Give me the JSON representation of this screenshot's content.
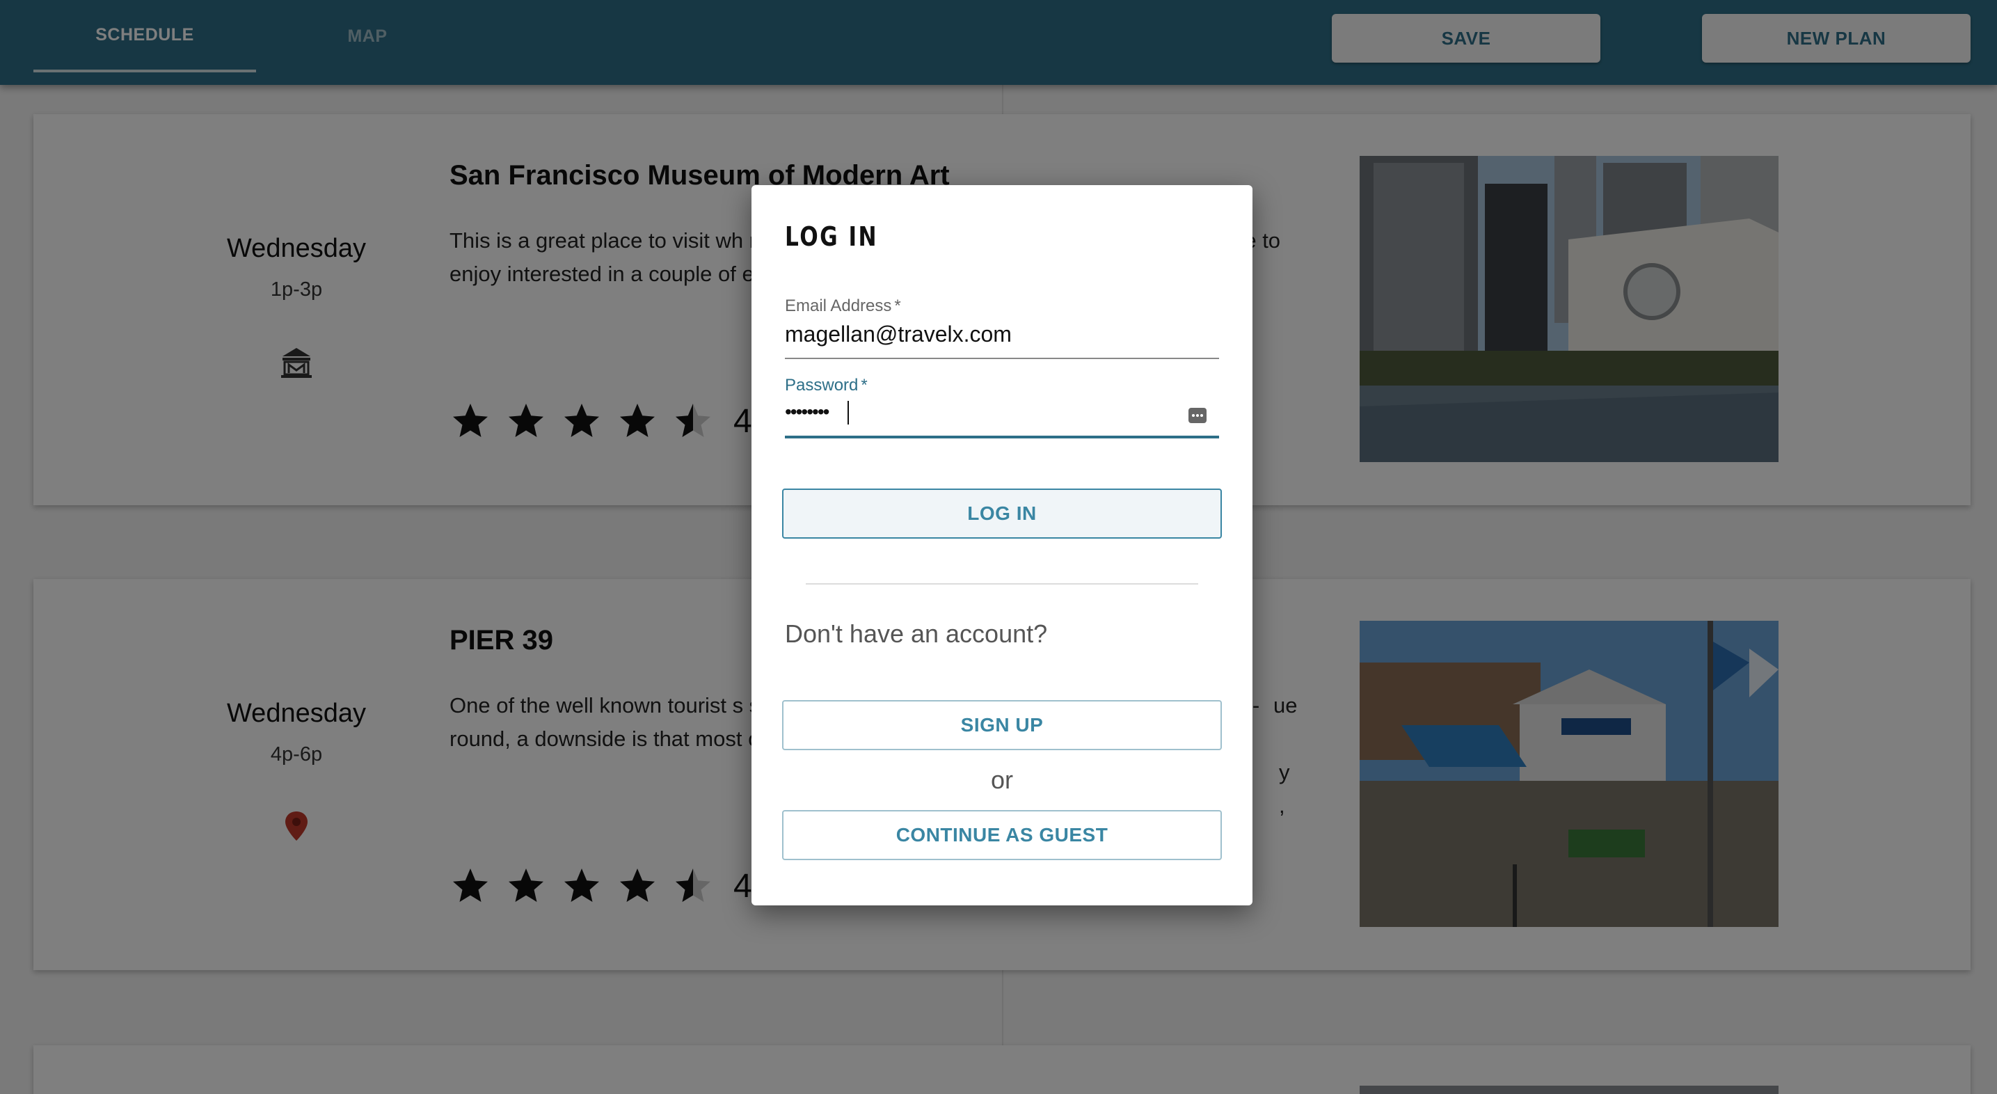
{
  "header": {
    "tabs": [
      {
        "label": "SCHEDULE",
        "active": true
      },
      {
        "label": "MAP",
        "active": false
      }
    ],
    "save_label": "SAVE",
    "new_plan_label": "NEW PLAN",
    "bar_color": "#2e6f88"
  },
  "activities": [
    {
      "day": "Wednesday",
      "time": "1p-3p",
      "category_icon": "museum-icon",
      "title": "San Francisco Museum of Modern Art",
      "description": "This is a great place to visit wh resident. A variety of art spreat yourself plenty of time to enjoy interested in a couple of exhib stroller, and other mobility aids",
      "rating": 4.5,
      "rating_label": "4",
      "photo": "city-skyline-museum-photo"
    },
    {
      "day": "Wednesday",
      "time": "4p-6p",
      "category_icon": "map-pin-icon",
      "title": "PIER 39",
      "description": "One of the well known tourist s souvenir shops. There great s musicians, a merry-go-round, a downside is that most of the sa options for vegetarian or peop",
      "description_right_fragments": [
        "ue",
        "y",
        ","
      ],
      "rating": 4.5,
      "rating_label": "4.5",
      "photo": "pier-39-photo"
    }
  ],
  "login_dialog": {
    "title": "LOG IN",
    "email": {
      "label": "Email Address",
      "required_mark": "*",
      "value": "magellan@travelx.com"
    },
    "password": {
      "label": "Password",
      "required_mark": "*",
      "masked_value": "••••••••",
      "focused": true
    },
    "login_button": "LOG IN",
    "no_account_text": "Don't have an account?",
    "signup_button": "SIGN UP",
    "or_text": "or",
    "guest_button": "CONTINUE AS GUEST",
    "accent_color": "#2e6f88"
  }
}
